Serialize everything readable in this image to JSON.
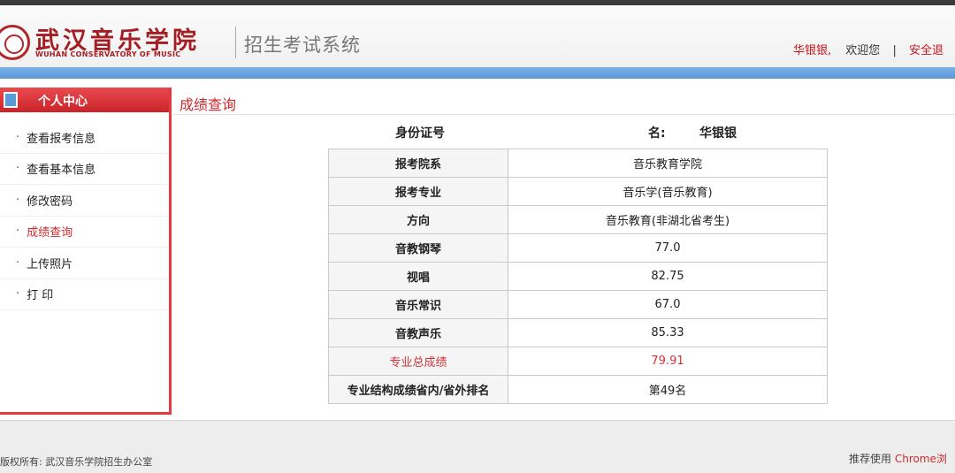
{
  "header": {
    "logo_cn": "武汉音乐学院",
    "logo_en": "WUHAN CONSERVATORY OF MUSIC",
    "system_title": "招生考试系统",
    "user_name": "华银银,",
    "welcome": "欢迎您",
    "separator": "|",
    "logout": "安全退"
  },
  "sidebar": {
    "title": "个人中心",
    "items": [
      {
        "label": "查看报考信息"
      },
      {
        "label": "查看基本信息"
      },
      {
        "label": "修改密码"
      },
      {
        "label": "成绩查询"
      },
      {
        "label": "上传照片"
      },
      {
        "label": "打 印"
      }
    ],
    "bullet": "·"
  },
  "main": {
    "title": "成绩查询",
    "id_label": "身份证号",
    "name_label": "名:",
    "name_value": "华银银",
    "rows": [
      {
        "key": "报考院系",
        "value": "音乐教育学院"
      },
      {
        "key": "报考专业",
        "value": "音乐学(音乐教育)"
      },
      {
        "key": "方向",
        "value": "音乐教育(非湖北省考生)"
      },
      {
        "key": "音教钢琴",
        "value": "77.0"
      },
      {
        "key": "视唱",
        "value": "82.75"
      },
      {
        "key": "音乐常识",
        "value": "67.0"
      },
      {
        "key": "音教声乐",
        "value": "85.33"
      },
      {
        "key": "专业总成绩",
        "value": "79.91"
      },
      {
        "key": "专业结构成绩省内/省外排名",
        "value": "第49名"
      }
    ]
  },
  "footer": {
    "copyright": "版权所有: 武汉音乐学院招生办公室",
    "recommend": "推荐使用",
    "browser": "Chrome浏"
  },
  "colors": {
    "accent_red": "#c8161d",
    "blue_bar": "#6aa3dd"
  }
}
